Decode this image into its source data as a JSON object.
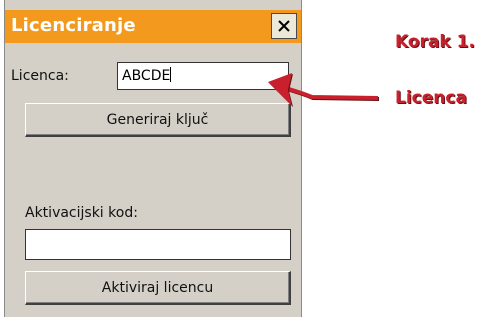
{
  "dialog": {
    "title": "Licenciranje",
    "license_label": "Licenca:",
    "license_value": "ABCDE",
    "generate_button": "Generiraj ključ",
    "activation_label": "Aktivacijski kod:",
    "activation_value": "",
    "activate_button": "Aktiviraj licencu"
  },
  "annotation": {
    "step": "Korak 1.",
    "pointer_label": "Licenca"
  },
  "colors": {
    "titlebar": "#f39a1e",
    "dialog_bg": "#d4d0c8",
    "annotation": "#c8202c"
  },
  "icons": {
    "close": "close-icon",
    "arrow": "arrow-icon"
  }
}
